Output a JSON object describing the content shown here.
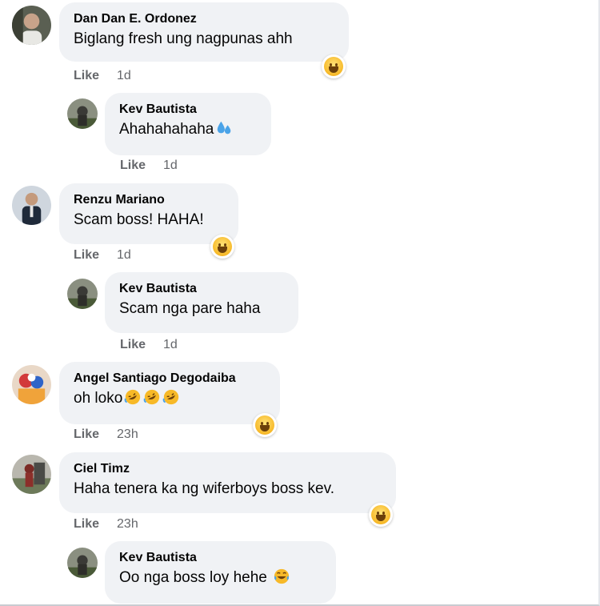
{
  "actions": {
    "like_label": "Like"
  },
  "comments": [
    {
      "name": "Dan Dan E. Ordonez",
      "text": "Biglang fresh ung nagpunas ahh",
      "time": "1d",
      "reaction": "haha"
    },
    {
      "name": "Kev Bautista",
      "text": "Ahahahahaha",
      "emoji": "sweat-droplets",
      "time": "1d"
    },
    {
      "name": "Renzu Mariano",
      "text": "Scam boss! HAHA!",
      "time": "1d",
      "reaction": "haha"
    },
    {
      "name": "Kev Bautista",
      "text": "Scam nga pare haha",
      "time": "1d"
    },
    {
      "name": "Angel Santiago Degodaiba",
      "text": "oh loko",
      "emoji": "rolling-on-floor-laughing x3",
      "time": "23h",
      "reaction": "haha"
    },
    {
      "name": "Ciel Timz",
      "text": "Haha tenera ka ng wiferboys boss kev.",
      "time": "23h",
      "reaction": "haha"
    },
    {
      "name": "Kev Bautista",
      "text": "Oo nga boss loy hehe",
      "emoji": "face-with-tears-of-joy"
    }
  ],
  "colors": {
    "bubble": "#f0f2f5",
    "meta": "#65676b",
    "text": "#050505",
    "reaction_yellow": "#f7b928"
  }
}
